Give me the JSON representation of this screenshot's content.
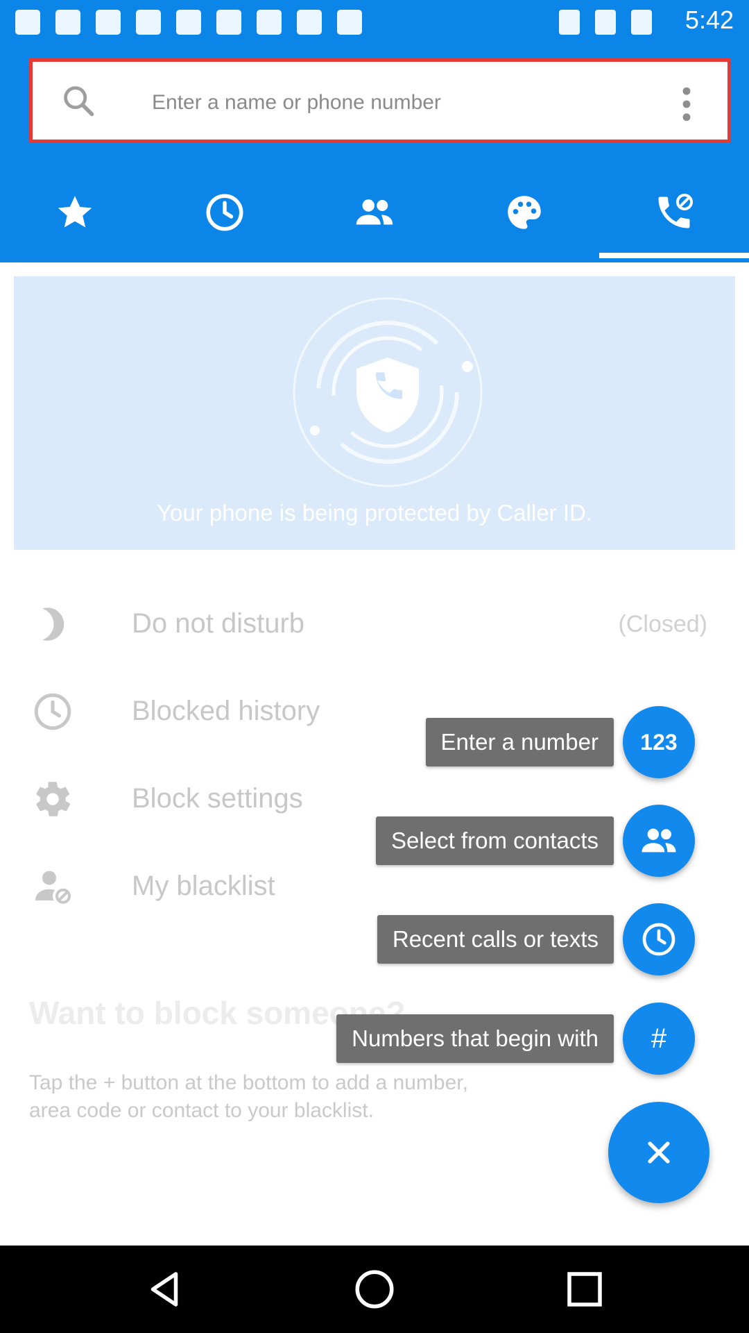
{
  "status_bar": {
    "time": "5:42"
  },
  "search": {
    "placeholder": "Enter a name or phone number"
  },
  "tabs": [
    {
      "name": "favorites",
      "icon": "star-icon"
    },
    {
      "name": "recents",
      "icon": "clock-icon"
    },
    {
      "name": "contacts",
      "icon": "people-icon"
    },
    {
      "name": "themes",
      "icon": "palette-icon"
    },
    {
      "name": "call-blocking",
      "icon": "phone-block-icon",
      "active": true
    }
  ],
  "banner": {
    "text": "Your phone is being protected by Caller ID.",
    "icon": "shield-phone-icon"
  },
  "rows": [
    {
      "label": "Do not disturb",
      "status": "(Closed)",
      "icon": "moon-icon"
    },
    {
      "label": "Blocked history",
      "icon": "clock-icon"
    },
    {
      "label": "Block settings",
      "icon": "gear-icon"
    },
    {
      "label": "My blacklist",
      "icon": "user-block-icon"
    }
  ],
  "empty_state": {
    "title": "Want to block someone?",
    "help_line1": "Tap the + button at the bottom to add a number,",
    "help_line2": "area code or contact to your blacklist."
  },
  "fab_menu": {
    "items": [
      {
        "label": "Enter a number",
        "badge": "123",
        "icon": "dialpad-icon"
      },
      {
        "label": "Select from contacts",
        "icon": "people-icon"
      },
      {
        "label": "Recent calls or texts",
        "icon": "clock-icon"
      },
      {
        "label": "Numbers that begin with",
        "badge": "#",
        "icon": "hash-icon"
      }
    ],
    "close_icon": "close-icon"
  },
  "colors": {
    "primary": "#0b86e8",
    "fab": "#1289ec",
    "highlight_border": "#e53935",
    "banner_bg": "#dbeafb",
    "label_bg": "#6f6f6f"
  }
}
